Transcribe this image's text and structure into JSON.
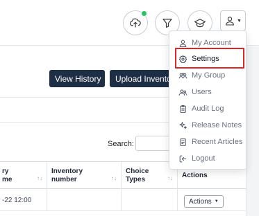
{
  "header": {
    "icons": [
      "cloud-upload-icon",
      "filter-icon",
      "graduation-cap-icon",
      "user-icon",
      "chevron-down-icon"
    ],
    "status_dot_color": "#22c55e"
  },
  "toolbar": {
    "view_history_label": "View History",
    "upload_inventory_label": "Upload Inventor"
  },
  "search": {
    "label": "Search:",
    "value": ""
  },
  "table": {
    "columns": [
      {
        "line1": "ry",
        "line2": "me"
      },
      {
        "line1": "Inventory",
        "line2": "number"
      },
      {
        "line1": "Choice",
        "line2": "Types"
      },
      {
        "line1": "Actions",
        "line2": ""
      }
    ],
    "rows": [
      {
        "date": "-22 12:00",
        "inventory_number": "",
        "choice_types": "",
        "actions_label": "Actions"
      }
    ]
  },
  "user_menu": {
    "items": [
      {
        "label": "My Account",
        "icon": "user-icon"
      },
      {
        "label": "Settings",
        "icon": "gear-icon",
        "highlighted": true
      },
      {
        "label": "My Group",
        "icon": "group-icon"
      },
      {
        "label": "Users",
        "icon": "users-icon"
      },
      {
        "label": "Audit Log",
        "icon": "clipboard-icon"
      },
      {
        "label": "Release Notes",
        "icon": "sparkle-icon"
      },
      {
        "label": "Recent Articles",
        "icon": "document-icon"
      },
      {
        "label": "Logout",
        "icon": "logout-icon"
      }
    ],
    "highlight_color": "#e02424"
  }
}
